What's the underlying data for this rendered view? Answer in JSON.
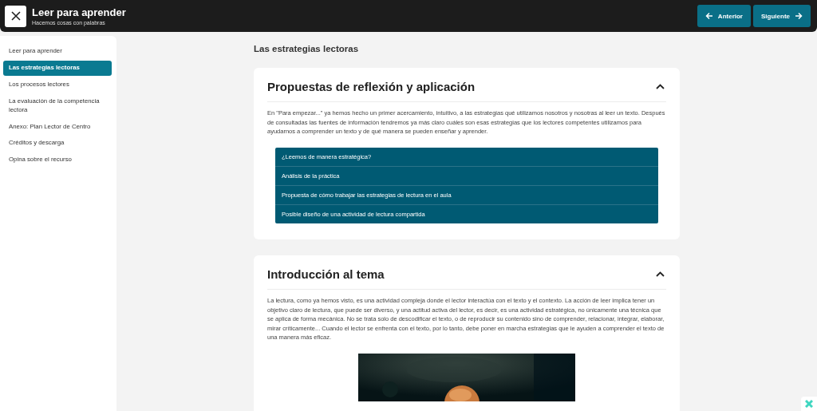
{
  "header": {
    "title": "Leer para aprender",
    "subtitle": "Hacemos cosas con palabras",
    "buttons": [
      {
        "kind": "prev",
        "label": "Anterior"
      },
      {
        "kind": "next",
        "label": "Siguiente"
      }
    ]
  },
  "sidebar": {
    "items": [
      {
        "label": "Leer para aprender",
        "selected": false
      },
      {
        "label": "Las estrategias lectoras",
        "selected": true
      },
      {
        "label": "Los procesos lectores",
        "selected": false
      },
      {
        "label": "La evaluación de la competencia lectora",
        "selected": false
      },
      {
        "label": "Anexo: Plan Lector de Centro",
        "selected": false
      },
      {
        "label": "Créditos y descarga",
        "selected": false
      },
      {
        "label": "Opina sobre el recurso",
        "selected": false
      }
    ]
  },
  "page_title": "Las estrategias lectoras",
  "sections": [
    {
      "title": "Propuestas de reflexión y aplicación",
      "expanded": true,
      "text": "En \"Para empezar...\" ya hemos hecho un primer acercamiento, intuitivo, a las estrategias qué utilizamos nosotros y nosotras al leer un texto. Después de consultadas las fuentes de información tendremos ya más claro cuáles son esas estrategias que los lectores competentes utilizamos para ayudarnos a comprender un texto y de qué manera se pueden enseñar y aprender.",
      "accordion": [
        "¿Leemos de manera estratégica?",
        "Análisis de la práctica",
        "Propuesta de cómo trabajar las estrategias de lectura en el aula",
        "Posible diseño de una actividad de lectura compartida"
      ]
    },
    {
      "title": "Introducción al tema",
      "expanded": true,
      "text": "La lectura, como ya hemos visto, es una actividad compleja donde el lector interactúa con el texto y el contexto. La acción de leer implica tener un objetivo claro de lectura, que puede ser diverso, y una actitud activa del lector, es decir, es una actividad estratégica, no únicamente una técnica que se aplica de forma mecánica. No se trata solo de descodificar el texto, o de reproducir su contenido sino de comprender, relacionar, integrar, elaborar, mirar críticamente... Cuando el lector se enfrenta con el texto, por lo tanto, debe poner en marcha estrategias que le ayuden a  comprender el texto de una manera más eficaz."
    }
  ]
}
